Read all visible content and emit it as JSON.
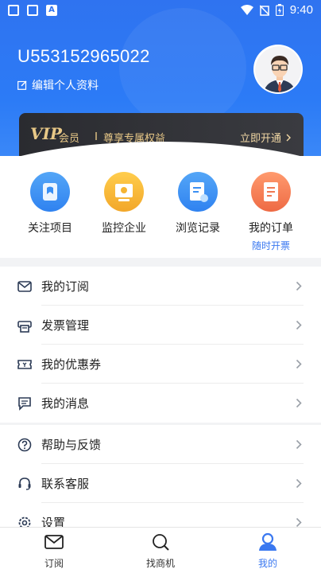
{
  "status_bar": {
    "time": "9:40"
  },
  "profile": {
    "user_id": "U553152965022",
    "edit_label": "编辑个人资料"
  },
  "vip": {
    "logo": "VIP",
    "member_label": "会员",
    "benefit_label": "尊享专属权益",
    "open_label": "立即开通"
  },
  "quick_actions": [
    {
      "label": "关注项目",
      "icon": "bookmark-icon",
      "color": "#3a8ff3"
    },
    {
      "label": "监控企业",
      "icon": "monitor-icon",
      "color": "#f5b432"
    },
    {
      "label": "浏览记录",
      "icon": "history-icon",
      "color": "#3a8ff3"
    },
    {
      "label": "我的订单",
      "icon": "order-icon",
      "color": "#f07a54",
      "sub": "随时开票"
    }
  ],
  "menu_group_1": [
    {
      "label": "我的订阅",
      "icon": "mail-icon"
    },
    {
      "label": "发票管理",
      "icon": "invoice-icon"
    },
    {
      "label": "我的优惠券",
      "icon": "coupon-icon"
    },
    {
      "label": "我的消息",
      "icon": "message-icon"
    }
  ],
  "menu_group_2": [
    {
      "label": "帮助与反馈",
      "icon": "help-icon"
    },
    {
      "label": "联系客服",
      "icon": "headset-icon"
    },
    {
      "label": "设置",
      "icon": "settings-icon"
    }
  ],
  "bottom_nav": [
    {
      "label": "订阅",
      "icon": "mail-icon"
    },
    {
      "label": "找商机",
      "icon": "search-icon"
    },
    {
      "label": "我的",
      "icon": "user-icon",
      "active": true
    }
  ],
  "colors": {
    "primary": "#2f73f0",
    "vip_gold": "#e8c887"
  }
}
